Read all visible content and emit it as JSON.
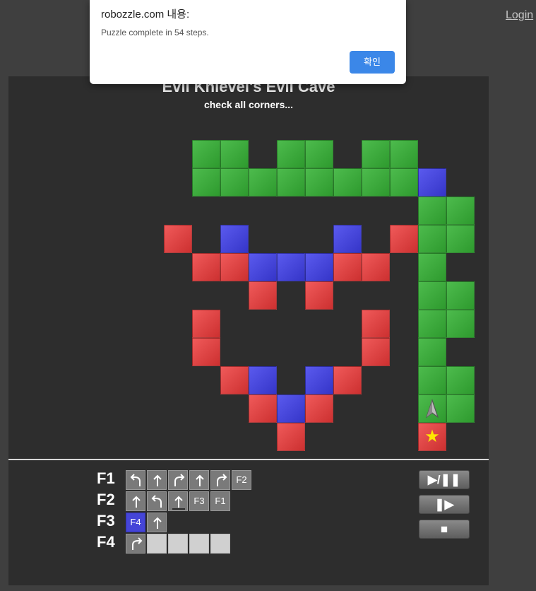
{
  "header": {
    "login_label": "Login"
  },
  "puzzle": {
    "title": "Evil Knievel's Evil Cave",
    "subtitle": "check all corners..."
  },
  "board": {
    "tiles": [
      {
        "col": 2,
        "row": 0,
        "color": "green"
      },
      {
        "col": 3,
        "row": 0,
        "color": "green"
      },
      {
        "col": 5,
        "row": 0,
        "color": "green"
      },
      {
        "col": 6,
        "row": 0,
        "color": "green"
      },
      {
        "col": 8,
        "row": 0,
        "color": "green"
      },
      {
        "col": 9,
        "row": 0,
        "color": "green"
      },
      {
        "col": 2,
        "row": 1,
        "color": "green"
      },
      {
        "col": 3,
        "row": 1,
        "color": "green"
      },
      {
        "col": 4,
        "row": 1,
        "color": "green"
      },
      {
        "col": 5,
        "row": 1,
        "color": "green"
      },
      {
        "col": 6,
        "row": 1,
        "color": "green"
      },
      {
        "col": 7,
        "row": 1,
        "color": "green"
      },
      {
        "col": 8,
        "row": 1,
        "color": "green"
      },
      {
        "col": 9,
        "row": 1,
        "color": "green"
      },
      {
        "col": 10,
        "row": 1,
        "color": "blue"
      },
      {
        "col": 10,
        "row": 2,
        "color": "green"
      },
      {
        "col": 11,
        "row": 2,
        "color": "green"
      },
      {
        "col": 1,
        "row": 3,
        "color": "red"
      },
      {
        "col": 3,
        "row": 3,
        "color": "blue"
      },
      {
        "col": 7,
        "row": 3,
        "color": "blue"
      },
      {
        "col": 9,
        "row": 3,
        "color": "red"
      },
      {
        "col": 10,
        "row": 3,
        "color": "green"
      },
      {
        "col": 11,
        "row": 3,
        "color": "green"
      },
      {
        "col": 2,
        "row": 4,
        "color": "red"
      },
      {
        "col": 3,
        "row": 4,
        "color": "red"
      },
      {
        "col": 4,
        "row": 4,
        "color": "blue"
      },
      {
        "col": 5,
        "row": 4,
        "color": "blue"
      },
      {
        "col": 6,
        "row": 4,
        "color": "blue"
      },
      {
        "col": 7,
        "row": 4,
        "color": "red"
      },
      {
        "col": 8,
        "row": 4,
        "color": "red"
      },
      {
        "col": 10,
        "row": 4,
        "color": "green"
      },
      {
        "col": 4,
        "row": 5,
        "color": "red"
      },
      {
        "col": 6,
        "row": 5,
        "color": "red"
      },
      {
        "col": 10,
        "row": 5,
        "color": "green"
      },
      {
        "col": 11,
        "row": 5,
        "color": "green"
      },
      {
        "col": 2,
        "row": 6,
        "color": "red"
      },
      {
        "col": 8,
        "row": 6,
        "color": "red"
      },
      {
        "col": 10,
        "row": 6,
        "color": "green"
      },
      {
        "col": 11,
        "row": 6,
        "color": "green"
      },
      {
        "col": 2,
        "row": 7,
        "color": "red"
      },
      {
        "col": 8,
        "row": 7,
        "color": "red"
      },
      {
        "col": 10,
        "row": 7,
        "color": "green"
      },
      {
        "col": 3,
        "row": 8,
        "color": "red"
      },
      {
        "col": 4,
        "row": 8,
        "color": "blue"
      },
      {
        "col": 6,
        "row": 8,
        "color": "blue"
      },
      {
        "col": 7,
        "row": 8,
        "color": "red"
      },
      {
        "col": 10,
        "row": 8,
        "color": "green"
      },
      {
        "col": 11,
        "row": 8,
        "color": "green"
      },
      {
        "col": 4,
        "row": 9,
        "color": "red"
      },
      {
        "col": 5,
        "row": 9,
        "color": "blue"
      },
      {
        "col": 6,
        "row": 9,
        "color": "red"
      },
      {
        "col": 10,
        "row": 9,
        "color": "green"
      },
      {
        "col": 11,
        "row": 9,
        "color": "green"
      },
      {
        "col": 5,
        "row": 10,
        "color": "red"
      },
      {
        "col": 10,
        "row": 10,
        "color": "red"
      }
    ],
    "stars": [
      {
        "col": 10,
        "row": 10
      }
    ],
    "robot": {
      "col": 10,
      "row": 9,
      "facing": "up"
    }
  },
  "program": {
    "functions": [
      {
        "label": "F1",
        "slots": [
          {
            "cmd": "turn-left"
          },
          {
            "cmd": "forward"
          },
          {
            "cmd": "turn-right"
          },
          {
            "cmd": "forward"
          },
          {
            "cmd": "turn-right"
          },
          {
            "cmd": "call",
            "text": "F2"
          }
        ]
      },
      {
        "label": "F2",
        "slots": [
          {
            "cmd": "forward"
          },
          {
            "cmd": "turn-left"
          },
          {
            "cmd": "forward",
            "marked": true
          },
          {
            "cmd": "call",
            "text": "F3"
          },
          {
            "cmd": "call",
            "text": "F1"
          }
        ]
      },
      {
        "label": "F3",
        "slots": [
          {
            "cmd": "call",
            "text": "F4",
            "color": "blue"
          },
          {
            "cmd": "forward"
          }
        ]
      },
      {
        "label": "F4",
        "slots": [
          {
            "cmd": "turn-right"
          },
          {
            "cmd": "empty"
          },
          {
            "cmd": "empty"
          },
          {
            "cmd": "empty"
          },
          {
            "cmd": "empty"
          }
        ]
      }
    ]
  },
  "controls": [
    {
      "name": "play-pause-button",
      "label": "▶/❚❚"
    },
    {
      "name": "step-button",
      "label": "❚▶"
    },
    {
      "name": "stop-button",
      "label": "■"
    }
  ],
  "dialog": {
    "title": "robozzle.com 내용:",
    "message": "Puzzle complete in 54 steps.",
    "ok_label": "확인"
  },
  "colors": {
    "green": "#3aa83a",
    "blue": "#4545d8",
    "red": "#de4444",
    "star": "#ffe600",
    "accent": "#3b87e8"
  }
}
